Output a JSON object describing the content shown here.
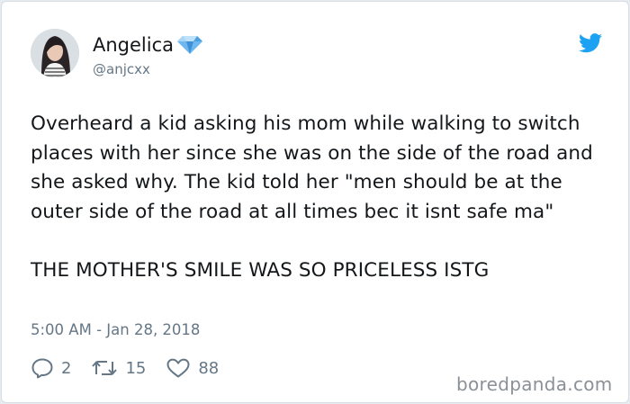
{
  "author": {
    "display_name": "Angelica",
    "handle": "@anjcxx",
    "verified_badge_icon": "diamond-icon"
  },
  "tweet": {
    "paragraphs": [
      "Overheard a kid asking his mom while walking to switch places with her since she was on the side of the road and she asked why. The kid told her \"men should be at the outer side of the road at all times bec it isnt safe ma\"",
      "THE MOTHER'S SMILE WAS SO PRICELESS ISTG"
    ],
    "timestamp": "5:00 AM - Jan 28, 2018"
  },
  "actions": {
    "replies": "2",
    "retweets": "15",
    "likes": "88"
  },
  "watermark": "boredpanda.com",
  "colors": {
    "twitter_blue": "#1da1f2",
    "secondary_text": "#657786",
    "diamond": "#6fb8ef"
  }
}
